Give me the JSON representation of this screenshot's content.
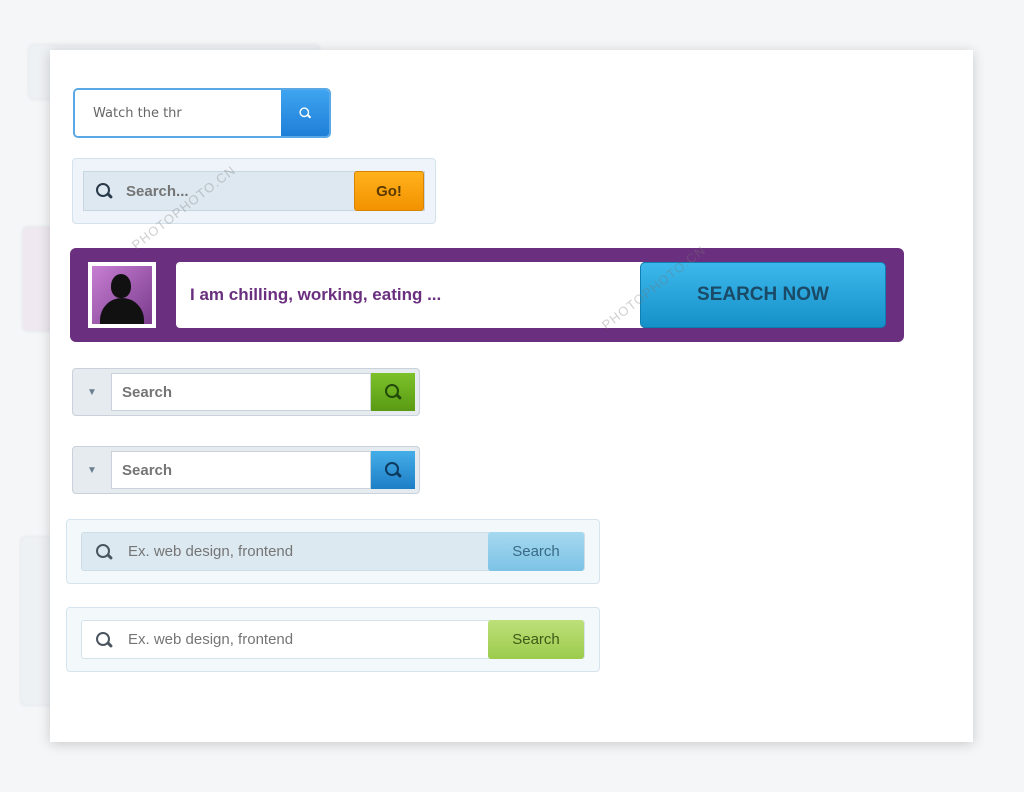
{
  "search1": {
    "value": "Watch the thr",
    "button_icon": "search-icon",
    "accent": "#2b8fe6"
  },
  "search2": {
    "placeholder": "Search...",
    "button": "Go!",
    "accent": "#f7a000"
  },
  "search3": {
    "status": "I am chilling, working, eating ...",
    "button": "SEARCH NOW",
    "avatar_icon": "user-silhouette-icon",
    "frame": "#6a2f7e",
    "accent": "#1e9fd6"
  },
  "search4": {
    "placeholder": "Search",
    "button_icon": "search-icon",
    "accent": "#6db01e"
  },
  "search5": {
    "placeholder": "Search",
    "button_icon": "search-icon",
    "accent": "#2d93d8"
  },
  "search6": {
    "placeholder": "Ex. web design, frontend",
    "button": "Search",
    "accent": "#8ccbe9"
  },
  "search7": {
    "placeholder": "Ex. web design, frontend",
    "button": "Search",
    "accent": "#a8d060"
  },
  "watermark": "PHOTOPHOTO.CN"
}
